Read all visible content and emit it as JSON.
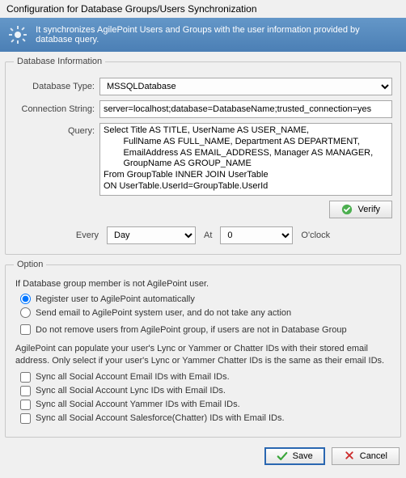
{
  "window": {
    "title": "Configuration for Database Groups/Users Synchronization"
  },
  "banner": {
    "text": "It synchronizes AgilePoint Users and Groups with the user information provided by database query."
  },
  "dbinfo": {
    "legend": "Database Information",
    "dbtype_label": "Database Type:",
    "dbtype_value": "MSSQLDatabase",
    "conn_label": "Connection String:",
    "conn_value": "server=localhost;database=DatabaseName;trusted_connection=yes",
    "query_label": "Query:",
    "query_value": "Select Title AS TITLE, UserName AS USER_NAME,\n        FullName AS FULL_NAME, Department AS DEPARTMENT,\n        EmailAddress AS EMAIL_ADDRESS, Manager AS MANAGER,\n        GroupName AS GROUP_NAME\nFrom GroupTable INNER JOIN UserTable\nON UserTable.UserId=GroupTable.UserId",
    "verify_label": "Verify",
    "every_label": "Every",
    "every_value": "Day",
    "at_label": "At",
    "at_value": "0",
    "oclock_label": "O'clock"
  },
  "option": {
    "legend": "Option",
    "intro": "If Database group member is not AgilePoint user.",
    "radio_register": "Register user to AgilePoint automatically",
    "radio_email": "Send email to AgilePoint system user, and do not take any action",
    "chk_noremove": "Do not remove users from AgilePoint group, if users are not in Database Group",
    "note": "AgilePoint can populate your user's Lync or Yammer or Chatter IDs with their stored email address. Only select if your user's Lync or Yammer Chatter IDs is the same as their email IDs.",
    "chk_email": "Sync all Social Account Email IDs with Email IDs.",
    "chk_lync": "Sync all Social Account Lync IDs with Email IDs.",
    "chk_yammer": "Sync all Social Account Yammer IDs with Email IDs.",
    "chk_chatter": "Sync all Social Account Salesforce(Chatter) IDs with Email IDs."
  },
  "footer": {
    "save": "Save",
    "cancel": "Cancel"
  }
}
